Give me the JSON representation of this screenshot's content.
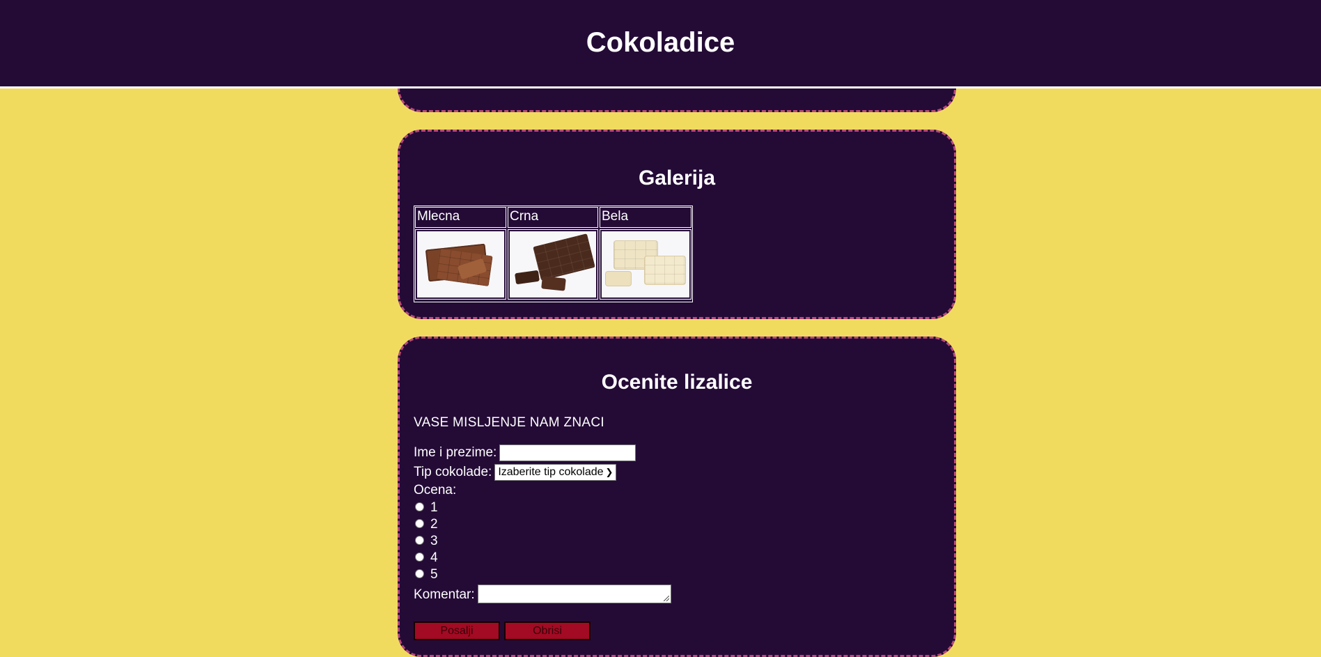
{
  "header": {
    "title": "Cokoladice"
  },
  "gallery": {
    "title": "Galerija",
    "columns": [
      "Mlecna",
      "Crna",
      "Bela"
    ]
  },
  "form": {
    "title": "Ocenite lizalice",
    "intro": "VASE MISLJENJE NAM ZNACI",
    "name_label": "Ime i prezime:",
    "name_value": "",
    "type_label": "Tip cokolade:",
    "type_selected": "Izaberite tip cokolade",
    "rating_label": "Ocena:",
    "rating_options": [
      "1",
      "2",
      "3",
      "4",
      "5"
    ],
    "comment_label": "Komentar:",
    "submit_label": "Posalji",
    "reset_label": "Obrisi"
  },
  "colors": {
    "page_background": "#f1db5f",
    "panel_background": "#240b36",
    "panel_border": "#b84a7c",
    "button": "#a30a23"
  }
}
